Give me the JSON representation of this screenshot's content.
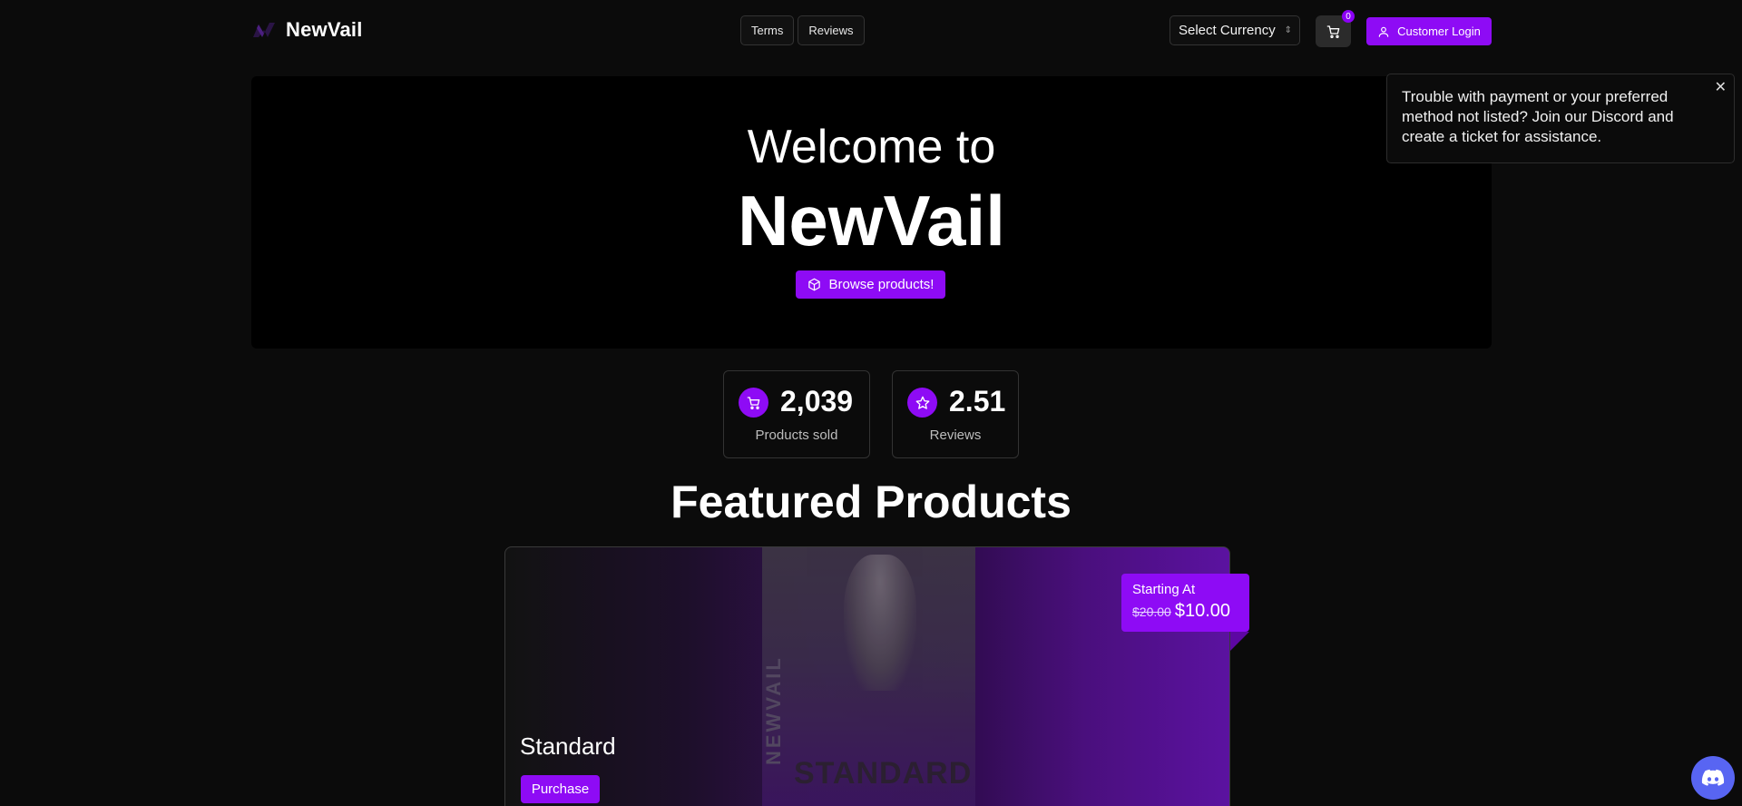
{
  "header": {
    "brand": "NewVail",
    "nav": [
      {
        "label": "Terms"
      },
      {
        "label": "Reviews"
      }
    ],
    "currency_select": "Select Currency",
    "cart_count": "0",
    "login_label": "Customer Login"
  },
  "hero": {
    "welcome": "Welcome to",
    "title": "NewVail",
    "browse_label": "Browse products!"
  },
  "toast": {
    "message": "Trouble with payment or your preferred method not listed? Join our Discord and create a ticket for assistance."
  },
  "stats": [
    {
      "value": "2,039",
      "label": "Products sold",
      "icon": "cart-icon"
    },
    {
      "value": "2.51",
      "label": "Reviews",
      "icon": "star-icon"
    }
  ],
  "featured": {
    "title": "Featured Products",
    "product": {
      "name": "Standard",
      "purchase_label": "Purchase",
      "price_label": "Starting At",
      "old_price": "$20.00",
      "price": "$10.00",
      "image_side_text": "NEWVAIL",
      "image_word": "STANDARD"
    }
  },
  "colors": {
    "accent": "#8e0bf5",
    "background": "#0b0b0b",
    "discord": "#5865f2"
  }
}
